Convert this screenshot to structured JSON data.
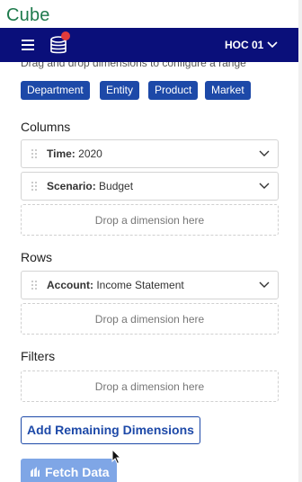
{
  "app": {
    "title": "Cube"
  },
  "navbar": {
    "workspace": "HOC 01",
    "menu_icon": "hamburger-icon",
    "db_icon": "database-icon"
  },
  "hint": "Drag and drop dimensions to configure a range",
  "available_dimensions": [
    "Department",
    "Entity",
    "Product",
    "Market"
  ],
  "columns": {
    "label": "Columns",
    "items": [
      {
        "name": "Time:",
        "value": "2020"
      },
      {
        "name": "Scenario:",
        "value": "Budget"
      }
    ],
    "drop_text": "Drop a dimension here"
  },
  "rows": {
    "label": "Rows",
    "items": [
      {
        "name": "Account:",
        "value": "Income Statement"
      }
    ],
    "drop_text": "Drop a dimension here"
  },
  "filters": {
    "label": "Filters",
    "drop_text": "Drop a dimension here"
  },
  "actions": {
    "add_remaining": "Add Remaining Dimensions",
    "fetch": "Fetch Data"
  },
  "colors": {
    "navbar": "#0a0f7a",
    "chip": "#1d49a8",
    "brand": "#1e7a4c",
    "fetch_disabled": "#7fa6e6"
  }
}
